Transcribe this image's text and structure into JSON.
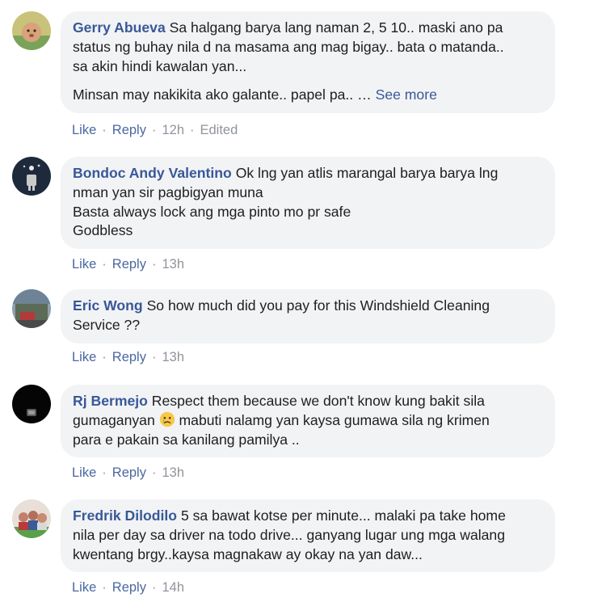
{
  "comments": [
    {
      "author": "Gerry Abueva",
      "lines": [
        "Sa halgang barya lang naman 2, 5 10.. maski ano pa",
        "status ng buhay nila d na masama ang mag bigay.. bata o matanda..",
        "sa akin hindi kawalan yan..."
      ],
      "extra": "Minsan may nakikita ako galante.. papel pa.. …",
      "see_more": "See more",
      "like": "Like",
      "reply": "Reply",
      "time": "12h",
      "edited": "Edited"
    },
    {
      "author": "Bondoc Andy Valentino",
      "lines": [
        "Ok lng yan atlis marangal barya barya lng",
        "nman yan sir pagbigyan muna",
        "Basta always lock ang mga pinto mo pr safe",
        "Godbless"
      ],
      "like": "Like",
      "reply": "Reply",
      "time": "13h"
    },
    {
      "author": "Eric Wong",
      "lines": [
        "So how much did you pay for this Windshield Cleaning",
        "Service ??"
      ],
      "like": "Like",
      "reply": "Reply",
      "time": "13h"
    },
    {
      "author": "Rj Bermejo",
      "lines": [
        "Respect them because we don't know kung bakit sila",
        "gumaganyan",
        "mabuti nalamg yan kaysa gumawa sila ng krimen",
        "para e pakain sa kanilang pamilya .."
      ],
      "emoji": "sad-face-emoji",
      "like": "Like",
      "reply": "Reply",
      "time": "13h"
    },
    {
      "author": "Fredrik Dilodilo",
      "lines": [
        "5 sa bawat kotse per minute... malaki pa take home",
        "nila per day sa driver na todo drive... ganyang lugar ung mga walang",
        "kwentang brgy..kaysa magnakaw ay okay na yan daw..."
      ],
      "like": "Like",
      "reply": "Reply",
      "time": "14h"
    }
  ],
  "colors": {
    "author": "#385898",
    "bubble": "#f2f3f5",
    "meta": "#90949c",
    "action_link": "#4b67a1"
  }
}
